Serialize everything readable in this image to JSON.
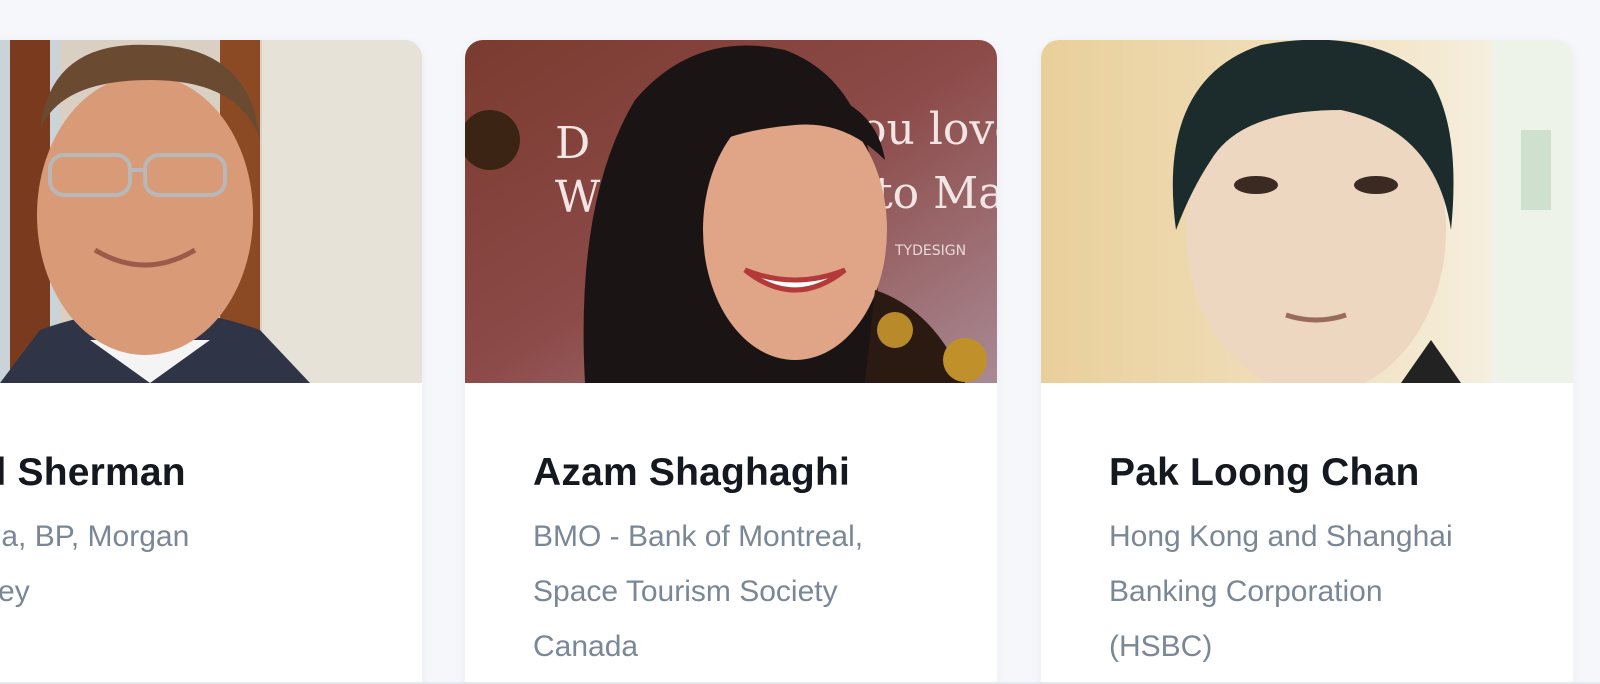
{
  "speakers": [
    {
      "name": "rill Sherman",
      "organization": "rdea, BP, Morgan\nenley",
      "org_lines": [
        "rdea, BP, Morgan",
        "enley"
      ]
    },
    {
      "name": "Azam Shaghaghi",
      "organization": "BMO - Bank of Montreal, Space Tourism Society Canada",
      "org_lines": [
        "BMO - Bank of Montreal,",
        "Space Tourism Society",
        "Canada"
      ],
      "photo_text": [
        "D",
        "ou love",
        "W",
        "to Ma",
        "TYDESIGN"
      ]
    },
    {
      "name": "Pak Loong Chan",
      "organization": "Hong Kong and Shanghai Banking Corporation (HSBC)",
      "org_lines": [
        "Hong Kong and Shanghai",
        "Banking Corporation",
        "(HSBC)"
      ]
    }
  ],
  "colors": {
    "page_background": "#f5f7fb",
    "card_background": "#ffffff",
    "name_text": "#14181f",
    "org_text": "#7a8796"
  }
}
